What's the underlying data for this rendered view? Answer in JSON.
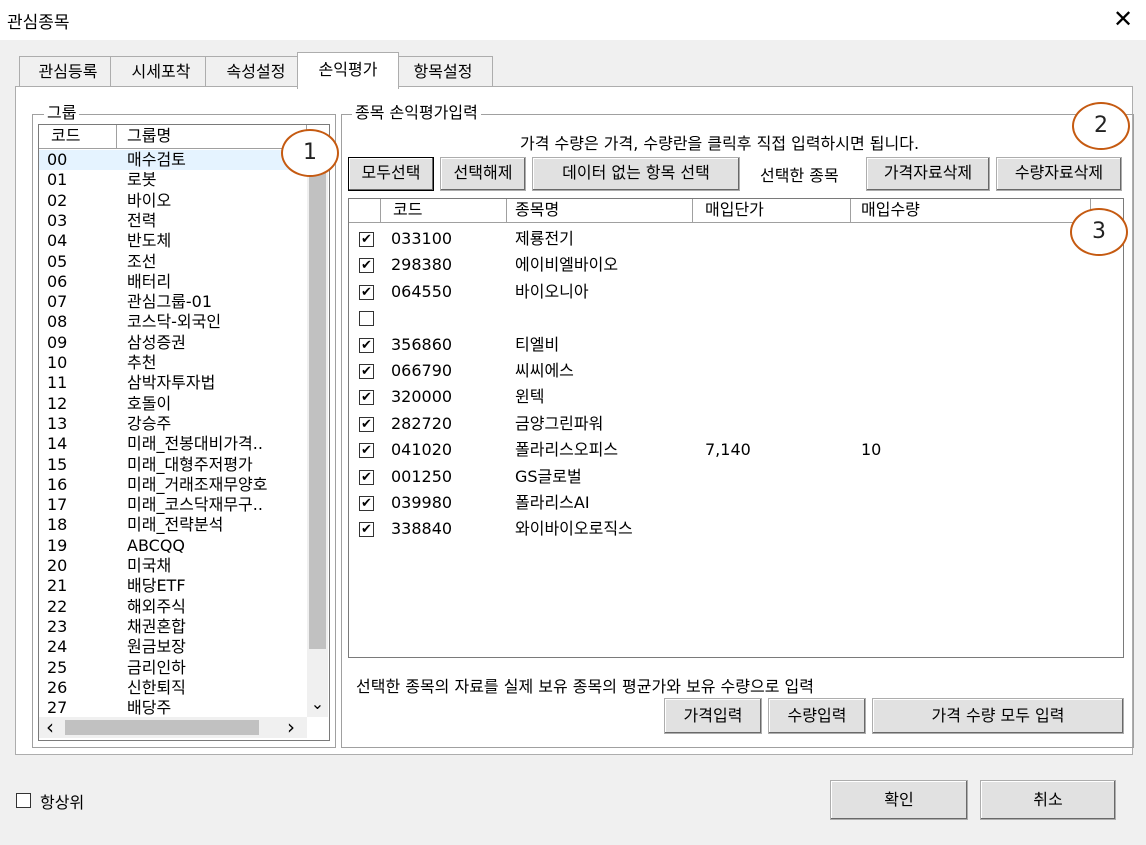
{
  "window": {
    "title": "관심종목",
    "close_glyph": "✕"
  },
  "tabs": [
    "관심등록",
    "시세포착",
    "속성설정",
    "손익평가",
    "항목설정"
  ],
  "group_panel": {
    "title": "그룹",
    "col_code": "코드",
    "col_name": "그룹명",
    "rows": [
      {
        "code": "00",
        "name": "매수검토"
      },
      {
        "code": "01",
        "name": "로봇"
      },
      {
        "code": "02",
        "name": "바이오"
      },
      {
        "code": "03",
        "name": "전력"
      },
      {
        "code": "04",
        "name": "반도체"
      },
      {
        "code": "05",
        "name": "조선"
      },
      {
        "code": "06",
        "name": "배터리"
      },
      {
        "code": "07",
        "name": "관심그룹-01"
      },
      {
        "code": "08",
        "name": "코스닥-외국인"
      },
      {
        "code": "09",
        "name": "삼성증권"
      },
      {
        "code": "10",
        "name": "추천"
      },
      {
        "code": "11",
        "name": "삼박자투자법"
      },
      {
        "code": "12",
        "name": "호돌이"
      },
      {
        "code": "13",
        "name": "강승주"
      },
      {
        "code": "14",
        "name": "미래_전봉대비가격.."
      },
      {
        "code": "15",
        "name": "미래_대형주저평가"
      },
      {
        "code": "16",
        "name": "미래_거래조재무양호"
      },
      {
        "code": "17",
        "name": "미래_코스닥재무구.."
      },
      {
        "code": "18",
        "name": "미래_전략분석"
      },
      {
        "code": "19",
        "name": "ABCQQ"
      },
      {
        "code": "20",
        "name": "미국채"
      },
      {
        "code": "21",
        "name": "배당ETF"
      },
      {
        "code": "22",
        "name": "해외주식"
      },
      {
        "code": "23",
        "name": "채권혼합"
      },
      {
        "code": "24",
        "name": "원금보장"
      },
      {
        "code": "25",
        "name": "금리인하"
      },
      {
        "code": "26",
        "name": "신한퇴직"
      },
      {
        "code": "27",
        "name": "배당주"
      }
    ]
  },
  "pl_panel": {
    "title": "종목 손익평가입력",
    "hint": "가격 수량은 가격, 수량란을 클릭후 직접 입력하시면 됩니다.",
    "buttons": {
      "select_all": "모두선택",
      "deselect": "선택해제",
      "select_empty": "데이터 없는 항목 선택",
      "selected_label": "선택한 종목",
      "delete_price": "가격자료삭제",
      "delete_qty": "수량자료삭제"
    },
    "columns": [
      "코드",
      "종목명",
      "매입단가",
      "매입수량"
    ],
    "rows": [
      {
        "checked": true,
        "code": "033100",
        "name": "제룡전기",
        "price": "",
        "qty": ""
      },
      {
        "checked": true,
        "code": "298380",
        "name": "에이비엘바이오",
        "price": "",
        "qty": ""
      },
      {
        "checked": true,
        "code": "064550",
        "name": "바이오니아",
        "price": "",
        "qty": ""
      },
      {
        "checked": false,
        "code": "",
        "name": "",
        "price": "",
        "qty": ""
      },
      {
        "checked": true,
        "code": "356860",
        "name": "티엘비",
        "price": "",
        "qty": ""
      },
      {
        "checked": true,
        "code": "066790",
        "name": "씨씨에스",
        "price": "",
        "qty": ""
      },
      {
        "checked": true,
        "code": "320000",
        "name": "윈텍",
        "price": "",
        "qty": ""
      },
      {
        "checked": true,
        "code": "282720",
        "name": "금양그린파워",
        "price": "",
        "qty": ""
      },
      {
        "checked": true,
        "code": "041020",
        "name": "폴라리스오피스",
        "price": "7,140",
        "qty": "10"
      },
      {
        "checked": true,
        "code": "001250",
        "name": "GS글로벌",
        "price": "",
        "qty": ""
      },
      {
        "checked": true,
        "code": "039980",
        "name": "폴라리스AI",
        "price": "",
        "qty": ""
      },
      {
        "checked": true,
        "code": "338840",
        "name": "와이바이오로직스",
        "price": "",
        "qty": ""
      }
    ],
    "bottom_text": "선택한 종목의 자료를 실제 보유 종목의 평균가와 보유 수량으로 입력",
    "bottom_buttons": {
      "price_input": "가격입력",
      "qty_input": "수량입력",
      "both_input": "가격 수량 모두 입력"
    }
  },
  "footer": {
    "always_on_top": "항상위",
    "ok": "확인",
    "cancel": "취소"
  },
  "callouts": [
    "1",
    "2",
    "3"
  ],
  "glyphs": {
    "check": "✔",
    "scroll_left": "‹",
    "scroll_right": "›",
    "scroll_down": "⌄"
  },
  "colors": {
    "callout_border": "#c55a11",
    "selected_row": "#e5f3ff"
  }
}
